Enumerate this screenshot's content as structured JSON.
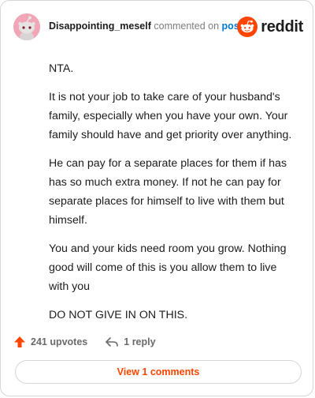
{
  "comment": {
    "author": "Disappointing_meself",
    "action_text": "commented on",
    "post_link": "post",
    "paragraphs": [
      "NTA.",
      "It is not your job to take care of your husband's family, especially when you have your own. Your family should have and get priority over anything.",
      "He can pay for a separate places for them if has has so much extra money. If not he can pay for separate places for himself to live with them but himself.",
      "You and your kids need room you grow. Nothing good will come of this is you allow them to live with you",
      "DO NOT GIVE IN ON THIS."
    ]
  },
  "brand": {
    "logo_text": "reddit",
    "logo_icon": "reddit-alien-icon",
    "accent_color": "#ff4500"
  },
  "footer": {
    "upvotes_label": "241 upvotes",
    "upvote_icon": "upvote-arrow-icon",
    "reply_label": "1 reply",
    "reply_icon": "reply-arrow-icon"
  },
  "view_comments": {
    "label": "View 1 comments"
  },
  "avatar": {
    "icon": "snoo-avatar-icon",
    "background": "#f0a6b6"
  }
}
